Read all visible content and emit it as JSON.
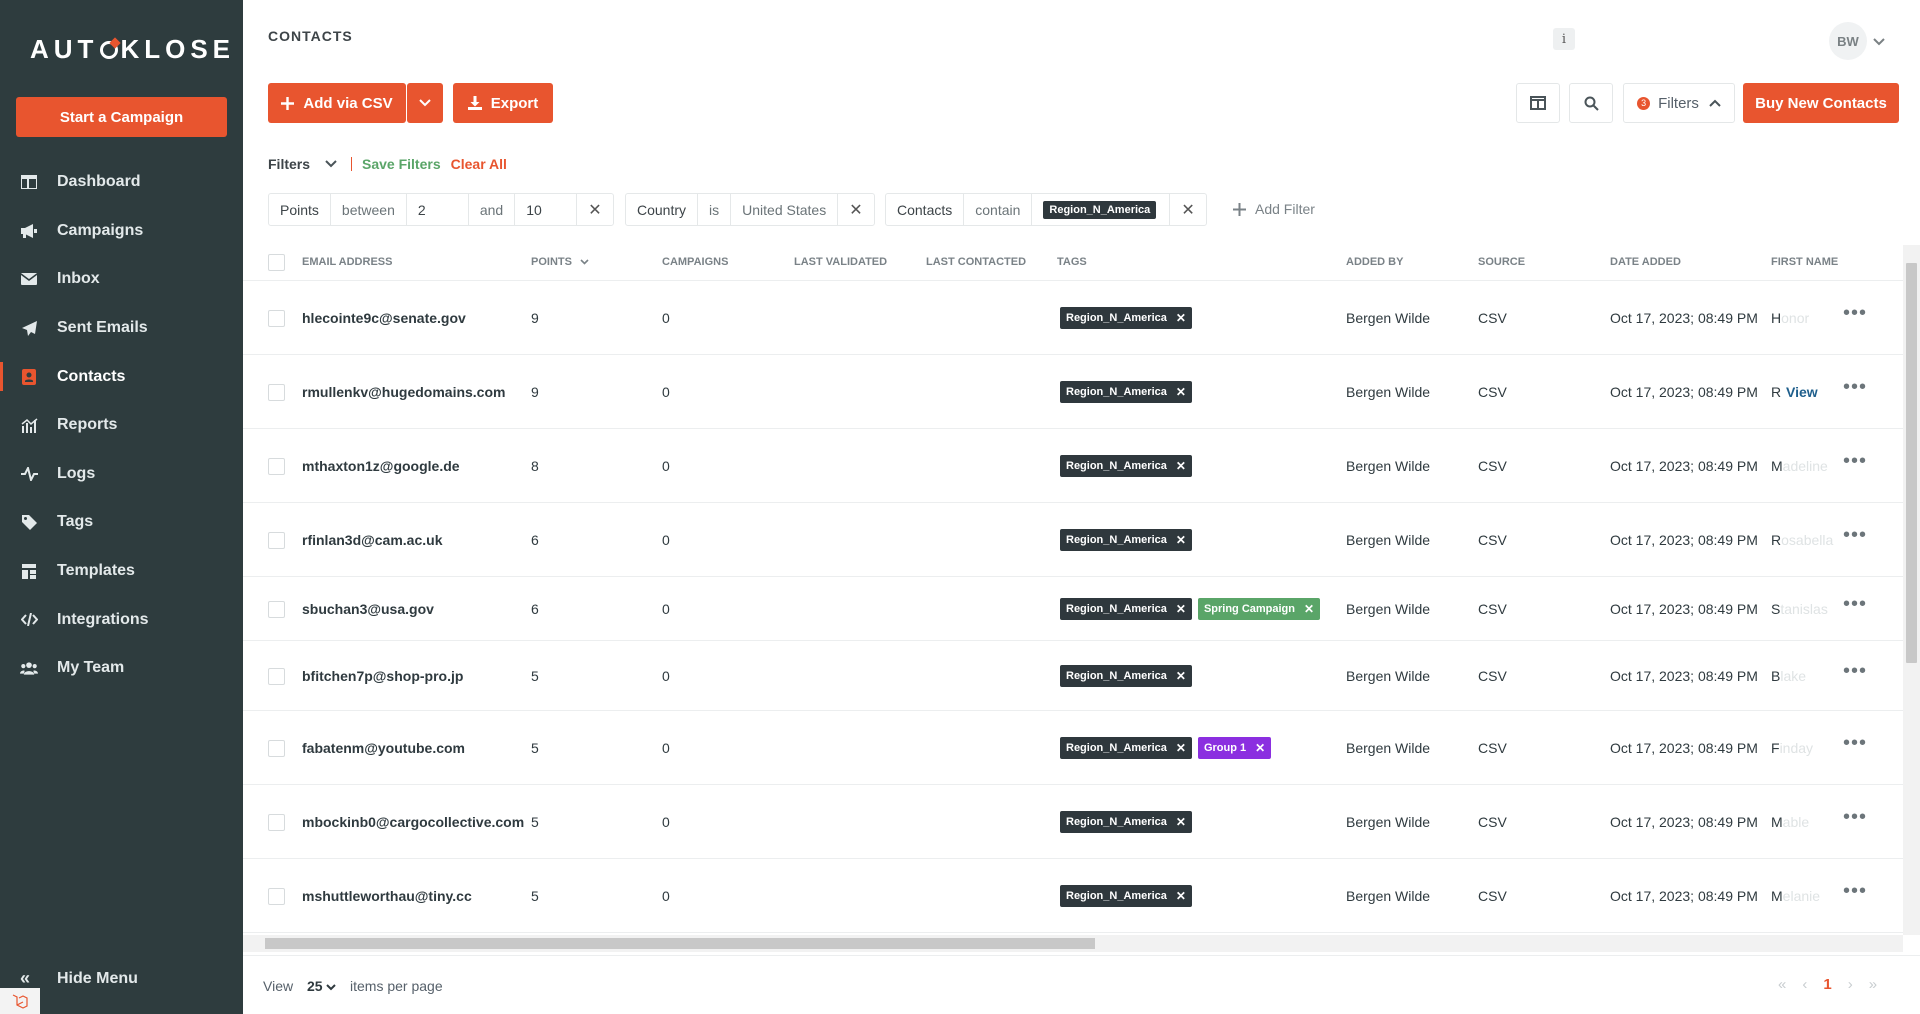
{
  "brand": {
    "logo_left": "AUT",
    "logo_right": "KLOSE"
  },
  "sidebar": {
    "start_campaign": "Start a Campaign",
    "items": [
      {
        "label": "Dashboard",
        "icon": "dashboard-icon"
      },
      {
        "label": "Campaigns",
        "icon": "megaphone-icon"
      },
      {
        "label": "Inbox",
        "icon": "envelope-icon"
      },
      {
        "label": "Sent Emails",
        "icon": "paper-plane-icon"
      },
      {
        "label": "Contacts",
        "icon": "address-book-icon",
        "active": true
      },
      {
        "label": "Reports",
        "icon": "chart-icon"
      },
      {
        "label": "Logs",
        "icon": "pulse-icon"
      },
      {
        "label": "Tags",
        "icon": "tag-icon"
      },
      {
        "label": "Templates",
        "icon": "templates-icon"
      },
      {
        "label": "Integrations",
        "icon": "code-icon"
      },
      {
        "label": "My Team",
        "icon": "team-icon"
      }
    ],
    "hide_menu": "Hide Menu"
  },
  "header": {
    "title": "CONTACTS",
    "info": "i",
    "avatar": "BW"
  },
  "toolbar": {
    "add_csv": "Add via CSV",
    "export": "Export",
    "filters": "Filters",
    "filter_count": "3",
    "buy": "Buy New Contacts"
  },
  "filterbar": {
    "label": "Filters",
    "save": "Save Filters",
    "clear": "Clear All",
    "add": "Add Filter",
    "chips": [
      {
        "field": "Points",
        "op": "between",
        "v1": "2",
        "mid": "and",
        "v2": "10"
      },
      {
        "field": "Country",
        "op": "is",
        "value": "United States"
      },
      {
        "field": "Contacts",
        "op": "contain",
        "value": "Region_N_America"
      }
    ]
  },
  "table": {
    "headers": [
      "EMAIL ADDRESS",
      "POINTS",
      "CAMPAIGNS",
      "LAST VALIDATED",
      "LAST CONTACTED",
      "TAGS",
      "ADDED BY",
      "SOURCE",
      "DATE ADDED",
      "FIRST NAME"
    ],
    "rows": [
      {
        "email": "hlecointe9c@senate.gov",
        "points": "9",
        "campaigns": "0",
        "tags": [
          {
            "name": "Region_N_America",
            "color": "dark"
          }
        ],
        "added_by": "Bergen Wilde",
        "source": "CSV",
        "date": "Oct 17, 2023; 08:49 PM",
        "first_initial": "H",
        "first_rest": "onor"
      },
      {
        "email": "rmullenkv@hugedomains.com",
        "points": "9",
        "campaigns": "0",
        "tags": [
          {
            "name": "Region_N_America",
            "color": "dark"
          }
        ],
        "added_by": "Bergen Wilde",
        "source": "CSV",
        "date": "Oct 17, 2023; 08:49 PM",
        "first_initial": "R",
        "first_rest": "",
        "view": "View"
      },
      {
        "email": "mthaxton1z@google.de",
        "points": "8",
        "campaigns": "0",
        "tags": [
          {
            "name": "Region_N_America",
            "color": "dark"
          }
        ],
        "added_by": "Bergen Wilde",
        "source": "CSV",
        "date": "Oct 17, 2023; 08:49 PM",
        "first_initial": "M",
        "first_rest": "adeline"
      },
      {
        "email": "rfinlan3d@cam.ac.uk",
        "points": "6",
        "campaigns": "0",
        "tags": [
          {
            "name": "Region_N_America",
            "color": "dark"
          }
        ],
        "added_by": "Bergen Wilde",
        "source": "CSV",
        "date": "Oct 17, 2023; 08:49 PM",
        "first_initial": "R",
        "first_rest": "osabella"
      },
      {
        "email": "sbuchan3@usa.gov",
        "points": "6",
        "campaigns": "0",
        "tags": [
          {
            "name": "Region_N_America",
            "color": "dark"
          },
          {
            "name": "Spring Campaign",
            "color": "green"
          }
        ],
        "added_by": "Bergen Wilde",
        "source": "CSV",
        "date": "Oct 17, 2023; 08:49 PM",
        "first_initial": "S",
        "first_rest": "tanislas"
      },
      {
        "email": "bfitchen7p@shop-pro.jp",
        "points": "5",
        "campaigns": "0",
        "tags": [
          {
            "name": "Region_N_America",
            "color": "dark"
          }
        ],
        "added_by": "Bergen Wilde",
        "source": "CSV",
        "date": "Oct 17, 2023; 08:49 PM",
        "first_initial": "B",
        "first_rest": "lake"
      },
      {
        "email": "fabatenm@youtube.com",
        "points": "5",
        "campaigns": "0",
        "tags": [
          {
            "name": "Region_N_America",
            "color": "dark"
          },
          {
            "name": "Group 1",
            "color": "purple"
          }
        ],
        "added_by": "Bergen Wilde",
        "source": "CSV",
        "date": "Oct 17, 2023; 08:49 PM",
        "first_initial": "F",
        "first_rest": "inday"
      },
      {
        "email": "mbockinb0@cargocollective.com",
        "points": "5",
        "campaigns": "0",
        "tags": [
          {
            "name": "Region_N_America",
            "color": "dark"
          }
        ],
        "added_by": "Bergen Wilde",
        "source": "CSV",
        "date": "Oct 17, 2023; 08:49 PM",
        "first_initial": "M",
        "first_rest": "able"
      },
      {
        "email": "mshuttleworthau@tiny.cc",
        "points": "5",
        "campaigns": "0",
        "tags": [
          {
            "name": "Region_N_America",
            "color": "dark"
          }
        ],
        "added_by": "Bergen Wilde",
        "source": "CSV",
        "date": "Oct 17, 2023; 08:49 PM",
        "first_initial": "M",
        "first_rest": "elanie"
      }
    ]
  },
  "pager": {
    "view": "View",
    "per_page": "25",
    "items_per_page": "items per page",
    "current_page": "1"
  },
  "colors": {
    "accent": "#e8552f",
    "sidebar": "#2e3c3e",
    "tag_dark": "#2f383d",
    "tag_green": "#5aa568",
    "tag_purple": "#8b2fe0"
  }
}
